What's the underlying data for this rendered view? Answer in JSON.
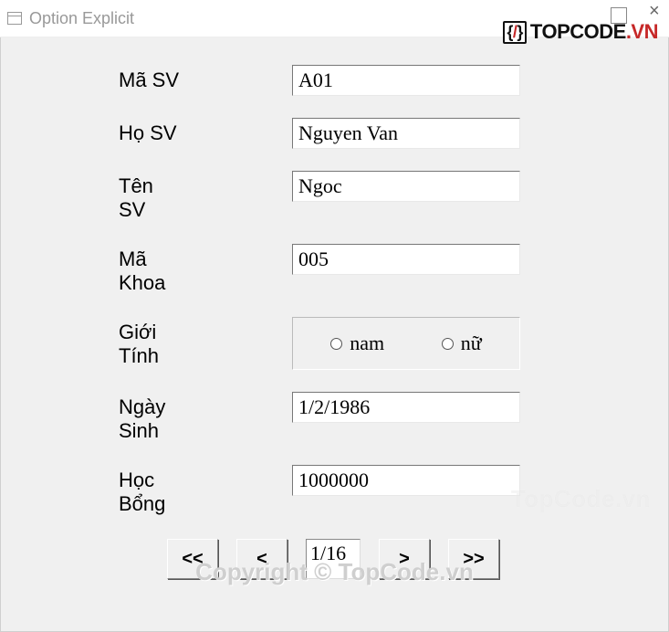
{
  "window": {
    "title": "Option Explicit"
  },
  "brand": {
    "prefix": "{",
    "slash": "/",
    "suffix": "}",
    "name": "TOPCODE",
    "tld": ".VN"
  },
  "labels": {
    "ma_sv": "Mã SV",
    "ho_sv": "Họ SV",
    "ten_sv": "Tên SV",
    "ma_khoa": "Mã Khoa",
    "gioi_tinh": "Giới Tính",
    "ngay_sinh": "Ngày Sinh",
    "hoc_bong": "Học Bổng"
  },
  "values": {
    "ma_sv": "A01",
    "ho_sv": "Nguyen Van",
    "ten_sv": "Ngoc",
    "ma_khoa": "005",
    "ngay_sinh": "1/2/1986",
    "hoc_bong": "1000000"
  },
  "gender": {
    "options": [
      "nam",
      "nữ"
    ]
  },
  "nav": {
    "first": "<<",
    "prev": "<",
    "counter": "1/16",
    "next": ">",
    "last": ">>"
  },
  "watermarks": {
    "small": "TopCode.vn",
    "large": "Copyright © TopCode.vn"
  }
}
